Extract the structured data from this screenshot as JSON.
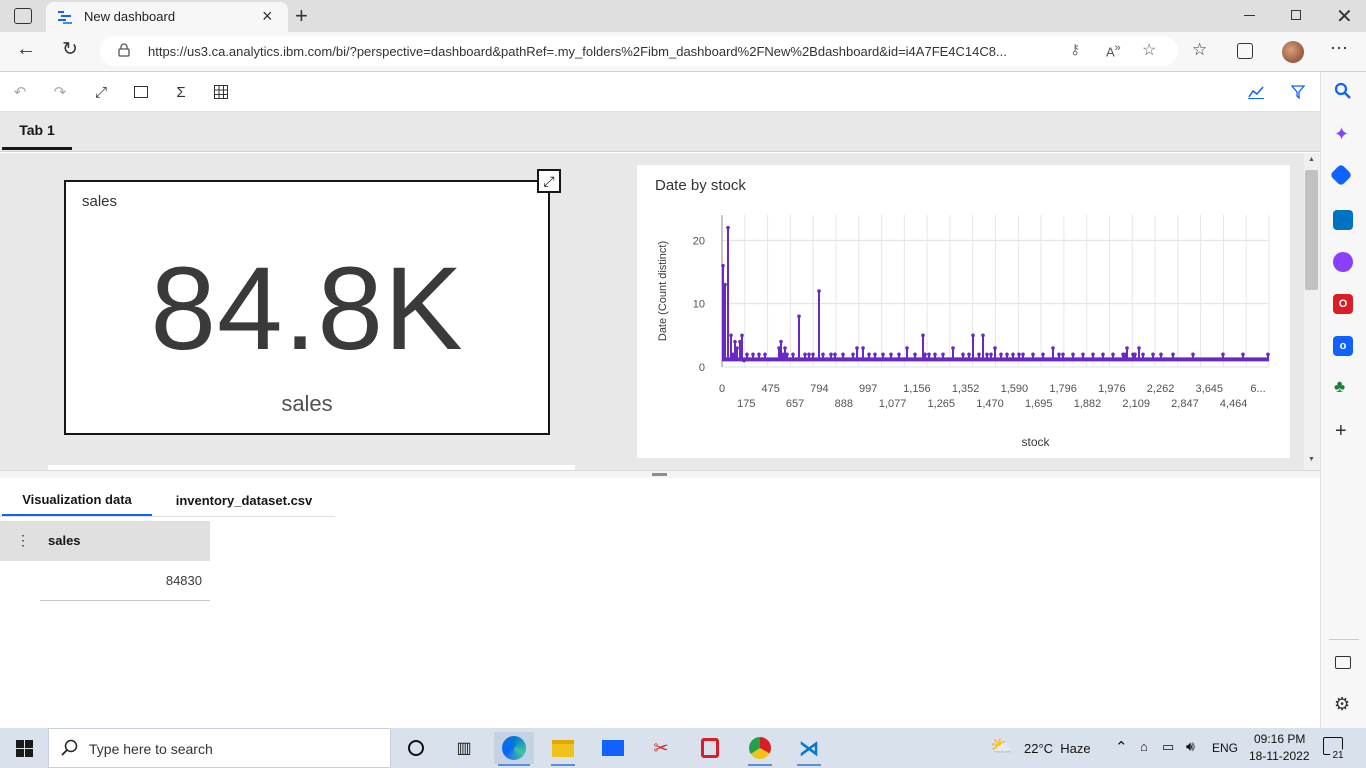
{
  "browser": {
    "tab_title": "New dashboard",
    "url": "https://us3.ca.analytics.ibm.com/bi/?perspective=dashboard&pathRef=.my_folders%2Fibm_dashboard%2FNew%2Bdashboard&id=i4A7FE4C14C8..."
  },
  "dashboard": {
    "tab_label": "Tab 1",
    "kpi": {
      "title": "sales",
      "value": "84.8K",
      "label": "sales"
    },
    "chart_title": "Date by stock"
  },
  "chart_data": {
    "type": "line",
    "title": "Date by stock",
    "xlabel": "stock",
    "ylabel": "Date (Count distinct)",
    "ylim": [
      0,
      24
    ],
    "yticks": [
      "0",
      "10",
      "20"
    ],
    "xtick_labels_top": [
      "0",
      "475",
      "794",
      "997",
      "1,156",
      "1,352",
      "1,590",
      "1,796",
      "1,976",
      "2,262",
      "3,645",
      "6..."
    ],
    "xtick_labels_bottom": [
      "175",
      "657",
      "888",
      "1,077",
      "1,265",
      "1,470",
      "1,695",
      "1,882",
      "2,109",
      "2,847",
      "4,464"
    ],
    "grid": true,
    "color": "#6929c4",
    "series": [
      {
        "x_index": [
          0,
          2,
          5,
          8,
          10,
          12,
          14,
          17,
          19,
          21,
          24,
          30,
          36,
          42,
          56,
          58,
          60,
          62,
          64,
          70,
          76,
          82,
          86,
          90,
          96,
          100,
          108,
          112,
          120,
          130,
          134,
          140,
          146,
          152,
          160,
          168,
          176,
          184,
          192,
          200,
          202,
          206,
          212,
          220,
          230,
          240,
          246,
          250,
          256,
          260,
          264,
          268,
          272,
          278,
          284,
          290,
          296,
          300,
          310,
          320,
          330,
          336,
          340,
          350,
          360,
          370,
          380,
          390,
          400,
          402,
          404,
          410,
          412,
          416,
          420,
          430,
          438,
          450,
          470,
          500,
          520,
          545
        ],
        "values": [
          16,
          13,
          22,
          5,
          2,
          4,
          3,
          4,
          5,
          1,
          2,
          2,
          2,
          2,
          3,
          4,
          2,
          3,
          2,
          2,
          8,
          2,
          2,
          2,
          12,
          2,
          2,
          2,
          2,
          2,
          3,
          3,
          2,
          2,
          2,
          2,
          2,
          3,
          2,
          5,
          2,
          2,
          2,
          2,
          3,
          2,
          2,
          5,
          2,
          5,
          2,
          2,
          3,
          2,
          2,
          2,
          2,
          2,
          2,
          2,
          3,
          2,
          2,
          2,
          2,
          2,
          2,
          2,
          2,
          2,
          3,
          2,
          2,
          3,
          2,
          2,
          2,
          2,
          2,
          2,
          2,
          2
        ]
      }
    ]
  },
  "data_panel": {
    "tabs": [
      "Visualization data",
      "inventory_dataset.csv"
    ],
    "column": "sales",
    "value": "84830"
  },
  "taskbar": {
    "search_placeholder": "Type here to search",
    "weather": "22°C  Haze",
    "language": "ENG",
    "time": "09:16 PM",
    "date": "18-11-2022",
    "notification_count": "21"
  }
}
